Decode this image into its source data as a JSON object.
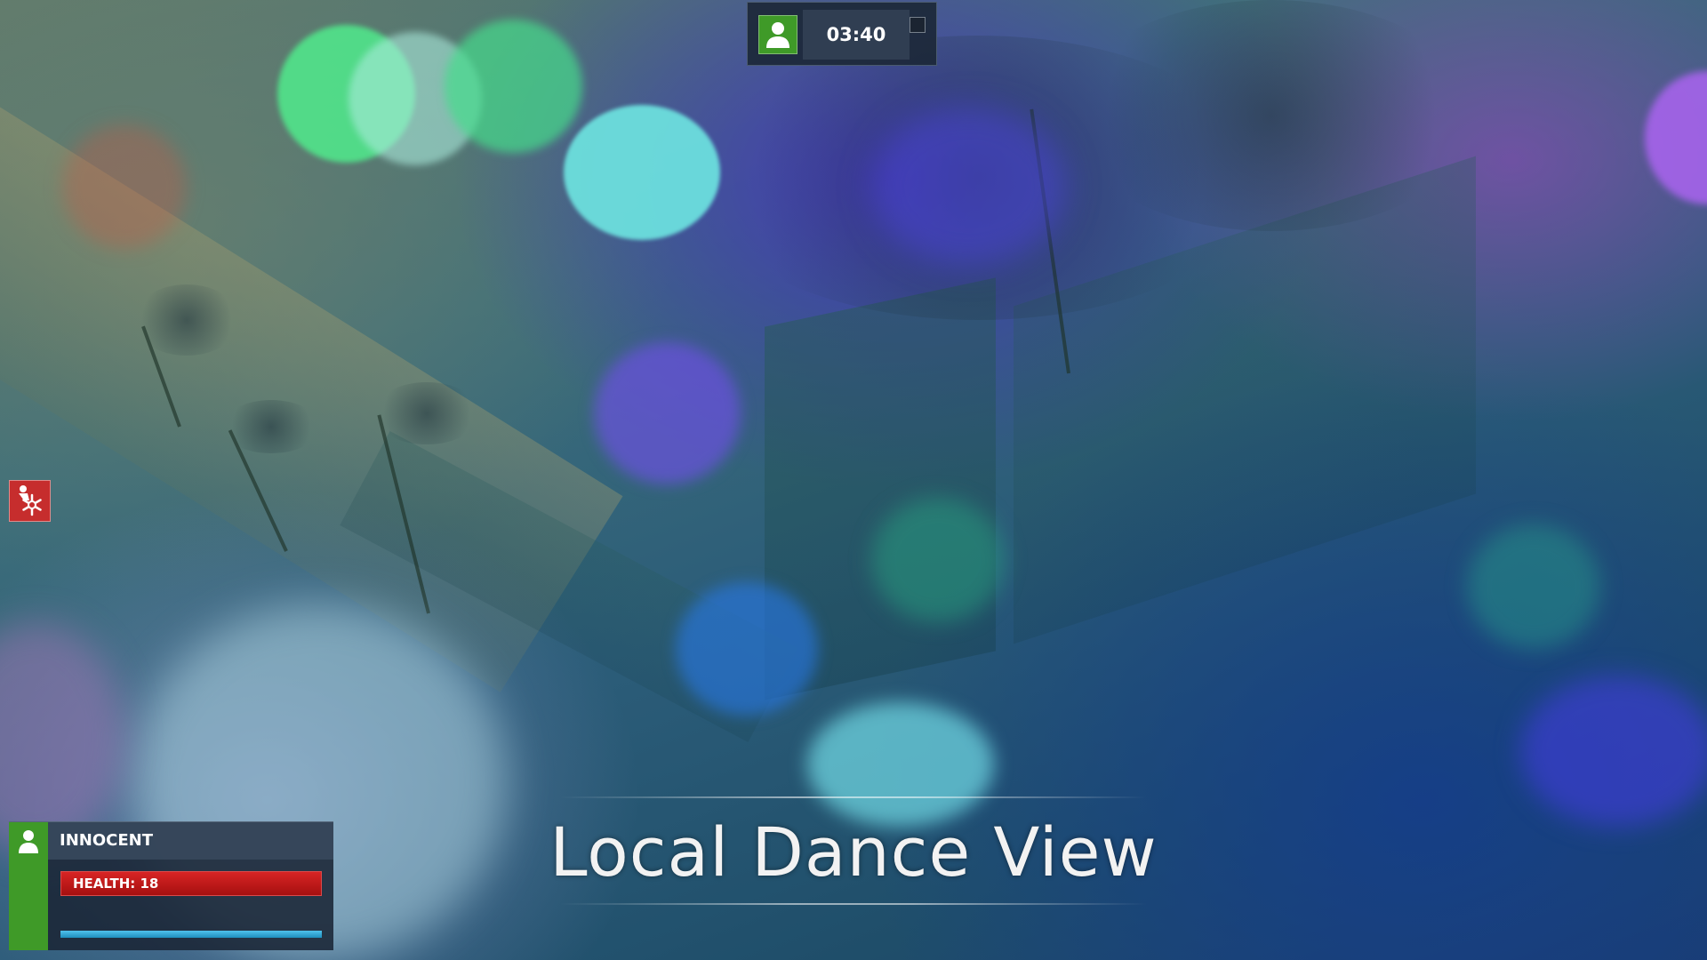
{
  "hud_timer": {
    "time": "03:40",
    "role_icon": "person-icon",
    "role_color": "#3f9a28"
  },
  "status_effect": {
    "icon": "frozen-person-icon",
    "color": "#c62d2d"
  },
  "player_hud": {
    "role": "INNOCENT",
    "role_icon": "person-icon",
    "role_color": "#3f9a28",
    "health_label": "HEALTH: 18",
    "health_value": 18,
    "health_color": "#c01a1a",
    "ammo_fill_fraction": 1.0,
    "ammo_color": "#2fa6d6"
  },
  "spectate": {
    "title": "Local Dance View"
  }
}
